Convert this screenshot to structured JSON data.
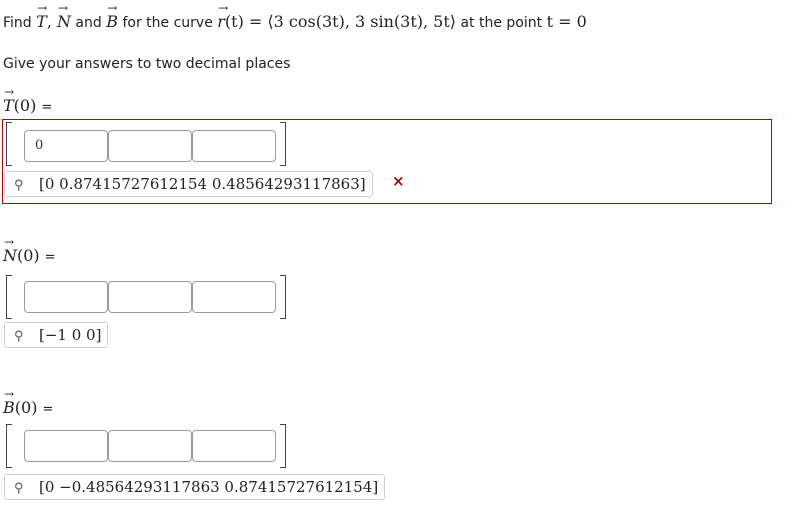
{
  "question": {
    "prefix": "Find ",
    "T_sym": "T",
    "sep1": ", ",
    "N_sym": "N",
    "and": " and ",
    "B_sym": "B",
    "for_curve": " for the curve ",
    "r_sym": "r",
    "r_expr": "(t) = ⟨3 cos(3t), 3 sin(3t), 5t⟩",
    "at_point": " at the point ",
    "point_expr": "t = 0",
    "instruction": "Give your answers to two decimal places"
  },
  "parts": {
    "T": {
      "label_sym": "T",
      "label_arg": "(0)",
      "eq": "=",
      "cells": [
        "0",
        "",
        ""
      ],
      "preview": "[0  0.87415727612154  0.48564293117863]",
      "status": "incorrect",
      "status_icon": "×"
    },
    "N": {
      "label_sym": "N",
      "label_arg": "(0)",
      "eq": "=",
      "cells": [
        "",
        "",
        ""
      ],
      "preview": "[−1  0  0]"
    },
    "B": {
      "label_sym": "B",
      "label_arg": "(0)",
      "eq": "=",
      "cells": [
        "",
        "",
        ""
      ],
      "preview": "[0  −0.48564293117863  0.87415727612154]"
    }
  },
  "colors": {
    "error": "#b30000",
    "input_border": "#9a9a9a"
  },
  "icons": {
    "preview": "preview-toggle-icon",
    "incorrect": "incorrect-x-icon"
  }
}
